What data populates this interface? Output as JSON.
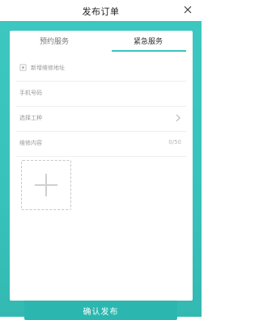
{
  "header": {
    "title": "发布订单",
    "close_icon": "close-icon"
  },
  "tabs": [
    {
      "label": "预约服务",
      "active": false
    },
    {
      "label": "紧急服务",
      "active": true
    }
  ],
  "form": {
    "address": {
      "label": "新增维修地址",
      "icon": "location-icon"
    },
    "phone": {
      "placeholder": "手机号码"
    },
    "work_type": {
      "label": "选择工种",
      "icon": "chevron-right-icon"
    },
    "content": {
      "placeholder": "维修内容",
      "counter": "0/50"
    }
  },
  "uploader": {
    "icon": "plus-icon"
  },
  "actions": {
    "confirm_label": "确认发布"
  },
  "colors": {
    "accent": "#38c5be",
    "button": "#2bb7b0"
  }
}
